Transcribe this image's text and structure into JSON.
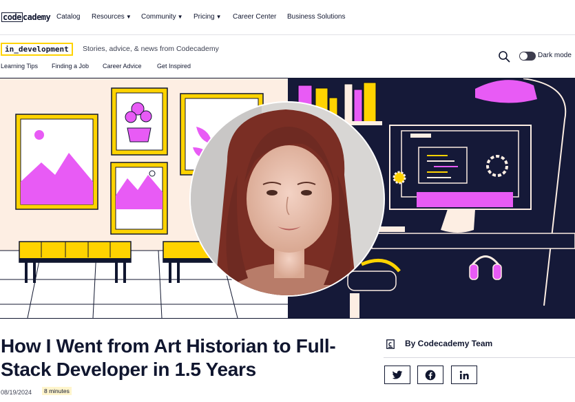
{
  "topnav": {
    "logo_box": "code",
    "logo_rest": "cademy",
    "items": [
      {
        "label": "Catalog",
        "caret": ""
      },
      {
        "label": "Resources",
        "caret": "▼"
      },
      {
        "label": "Community",
        "caret": "▼"
      },
      {
        "label": "Pricing",
        "caret": "▼"
      },
      {
        "label": "Career Center",
        "caret": ""
      },
      {
        "label": "Business Solutions",
        "caret": ""
      }
    ]
  },
  "blog": {
    "badge": "in_development",
    "tagline": "Stories, advice, & news from Codecademy",
    "subnav": [
      "Learning Tips",
      "Finding a Job",
      "Career Advice",
      "Get Inspired"
    ],
    "dark_mode_label": "Dark mode"
  },
  "article": {
    "title": "How I Went from Art Historian to Full-Stack Developer in 1.5 Years",
    "date": "08/19/2024",
    "read_time": "8 minutes",
    "author": "By Codecademy Team"
  },
  "icons": {
    "search": "search-icon",
    "author": "codecademy-logo-icon",
    "share": [
      "twitter-icon",
      "facebook-icon",
      "linkedin-icon"
    ]
  },
  "colors": {
    "brand_navy": "#10162f",
    "accent_yellow": "#ffd300",
    "accent_magenta": "#e85bf5",
    "hero_left_bg": "#fdeee3",
    "hero_right_bg": "#151938"
  }
}
